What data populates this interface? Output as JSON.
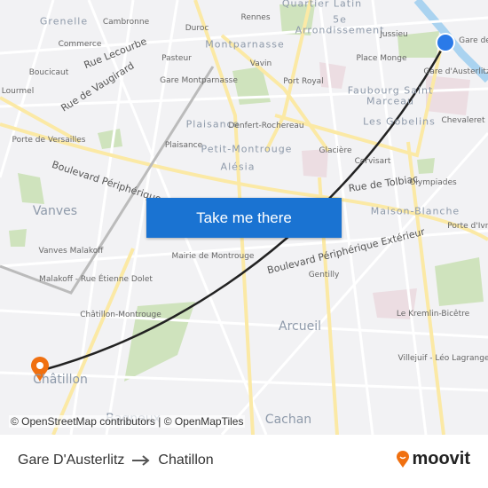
{
  "map": {
    "labels": [
      "Grenelle",
      "Cambronne",
      "Commerce",
      "Rue Lecourbe",
      "Boucicaut",
      "Rue de Vaugirard",
      "Lourmel",
      "Porte de Versailles",
      "Boulevard Périphérique",
      "Vanves",
      "Vanves Malakoff",
      "Malakoff - Rue Étienne Dolet",
      "Châtillon-Montrouge",
      "Duroc",
      "Rennes",
      "Quartier Latin",
      "5e",
      "Arrondissement",
      "Jussieu",
      "Montparnasse",
      "Pasteur",
      "Vavin",
      "Gare Montparnasse",
      "Port Royal",
      "Place Monge",
      "Gare d'Austerlitz",
      "Faubourg Saint",
      "Marceau",
      "Plaisance",
      "Denfert-Rochereau",
      "Les Gobelins",
      "Chevaleret",
      "Plaisance",
      "Petit-Montrouge",
      "Glacière",
      "Corvisart",
      "Alésia",
      "Rue de Tolbiac",
      "Olympiades",
      "Maison-Blanche",
      "Porte d'Ivry",
      "Boulevard Périphérique Extérieur",
      "Mairie de Montrouge",
      "Gentilly",
      "Arcueil",
      "Le Kremlin-Bicêtre",
      "Villejuif - Léo Lagrange",
      "Cachan",
      "Bagneux",
      "Gare de"
    ],
    "origin": "Gare D'Austerlitz",
    "destination_label": "Châtillon",
    "colors": {
      "route": "#222222",
      "origin": "#2a7ae8",
      "destination": "#f07010",
      "button": "#1a73d2",
      "park": "#cfe3bd",
      "major_road": "#fbe9a5",
      "water": "#aad3f0"
    }
  },
  "cta": {
    "label": "Take me there"
  },
  "attribution": "© OpenStreetMap contributors | © OpenMapTiles",
  "footer": {
    "origin": "Gare D'Austerlitz",
    "destination": "Chatillon",
    "arrow_icon": "arrow-right",
    "brand": "moovit"
  }
}
